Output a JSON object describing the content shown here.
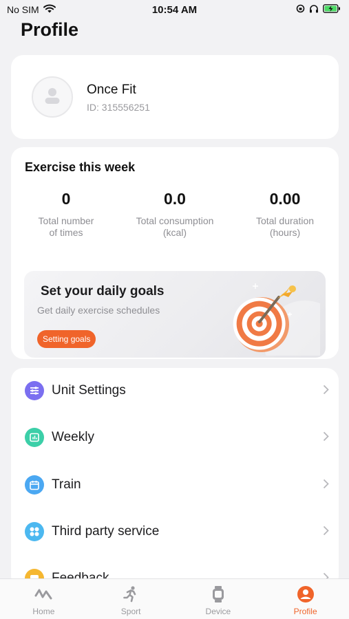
{
  "status_bar": {
    "carrier": "No SIM",
    "time": "10:54 AM"
  },
  "page": {
    "title": "Profile"
  },
  "profile": {
    "name": "Once Fit",
    "id_text": "ID: 315556251"
  },
  "exercise": {
    "title": "Exercise this week",
    "stats": [
      {
        "value": "0",
        "label_line1": "Total number",
        "label_line2": "of times"
      },
      {
        "value": "0.0",
        "label_line1": "Total consumption",
        "label_line2": "(kcal)"
      },
      {
        "value": "0.00",
        "label_line1": "Total duration",
        "label_line2": "(hours)"
      }
    ]
  },
  "goals": {
    "title": "Set your daily goals",
    "subtitle": "Get daily exercise schedules",
    "button_label": "Setting goals"
  },
  "menu": {
    "items": [
      {
        "label": "Unit Settings",
        "icon": "sliders-icon",
        "color": "#7b6ff0"
      },
      {
        "label": "Weekly",
        "icon": "weekly-chart-icon",
        "color": "#3ccfa8"
      },
      {
        "label": "Train",
        "icon": "calendar-icon",
        "color": "#4ba8f2"
      },
      {
        "label": "Third party service",
        "icon": "grid-icon",
        "color": "#4cb8f0"
      },
      {
        "label": "Feedback",
        "icon": "feedback-icon",
        "color": "#f5b731"
      }
    ]
  },
  "tabs": [
    {
      "label": "Home",
      "icon": "home-wave-icon"
    },
    {
      "label": "Sport",
      "icon": "runner-icon"
    },
    {
      "label": "Device",
      "icon": "watch-icon"
    },
    {
      "label": "Profile",
      "icon": "profile-icon",
      "active": true
    }
  ],
  "colors": {
    "accent": "#f0642a",
    "background": "#f2f2f4"
  }
}
